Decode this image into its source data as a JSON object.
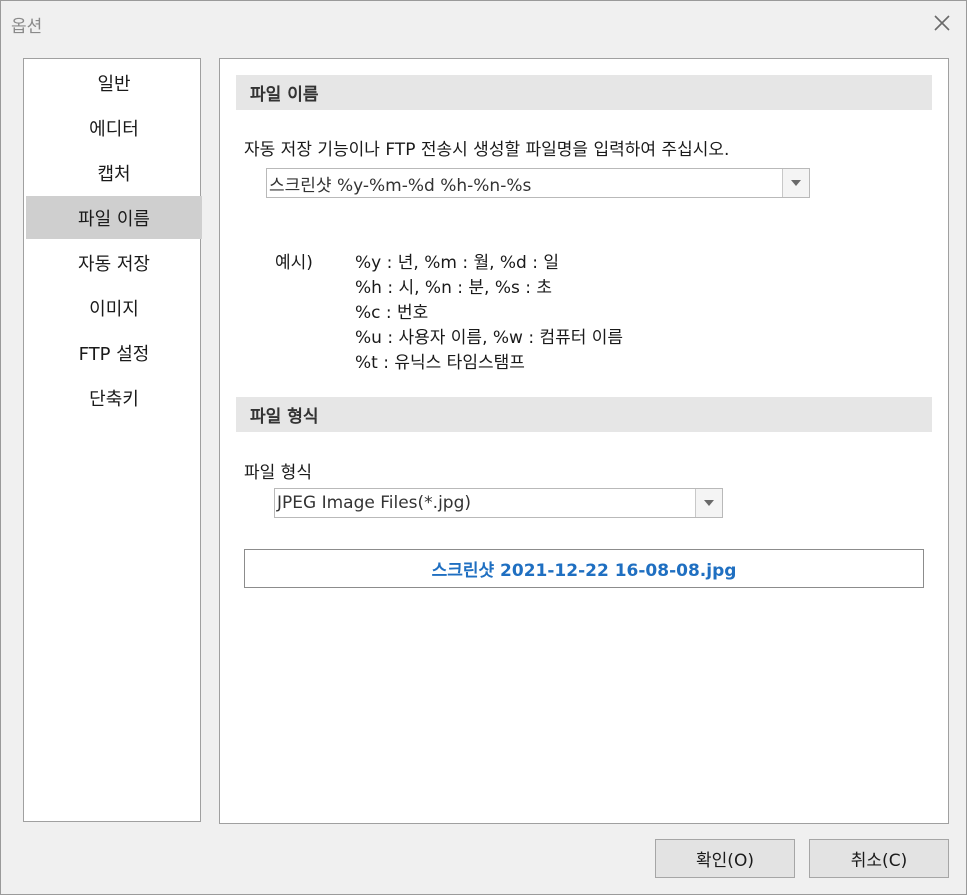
{
  "window": {
    "title": "옵션"
  },
  "sidebar": {
    "items": [
      {
        "label": "일반",
        "active": false
      },
      {
        "label": "에디터",
        "active": false
      },
      {
        "label": "캡처",
        "active": false
      },
      {
        "label": "파일 이름",
        "active": true
      },
      {
        "label": "자동 저장",
        "active": false
      },
      {
        "label": "이미지",
        "active": false
      },
      {
        "label": "FTP 설정",
        "active": false
      },
      {
        "label": "단축키",
        "active": false
      }
    ]
  },
  "filename_section": {
    "header": "파일 이름",
    "description": "자동 저장 기능이나 FTP 전송시 생성할 파일명을 입력하여 주십시오.",
    "pattern_value": "스크린샷 %y-%m-%d %h-%n-%s",
    "example_label": "예시)",
    "example_lines": [
      "%y : 년, %m : 월, %d : 일",
      "%h : 시, %n : 분, %s : 초",
      "%c : 번호",
      "%u : 사용자 이름, %w : 컴퓨터 이름",
      "%t : 유닉스 타임스탬프"
    ]
  },
  "format_section": {
    "header": "파일 형식",
    "label": "파일 형식",
    "format_value": "JPEG Image Files(*.jpg)"
  },
  "preview": {
    "filename": "스크린샷 2021-12-22 16-08-08.jpg"
  },
  "buttons": {
    "ok_label": "확인(O)",
    "cancel_label": "취소(C)"
  },
  "colors": {
    "preview_text": "#1f6fc1",
    "active_item_bg": "#cfcfcf"
  }
}
